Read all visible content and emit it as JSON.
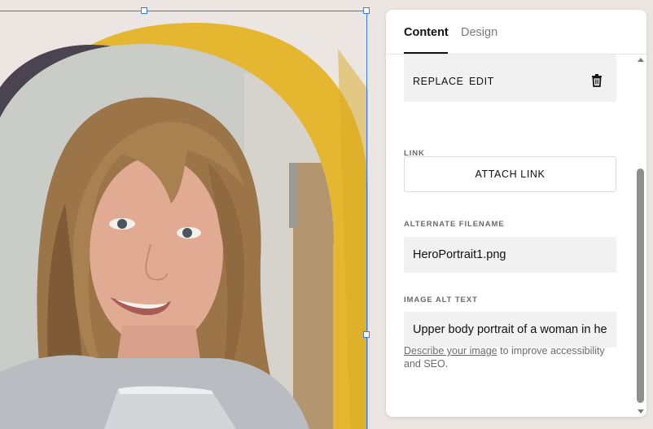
{
  "canvas": {
    "image_alt": "Upper body portrait of a woman",
    "colors": {
      "yellow": "#e5b730",
      "dark_arch": "#4a4350",
      "background": "#ebe6e1",
      "selection": "#3d7be0"
    }
  },
  "panel": {
    "tabs": [
      {
        "label": "Content",
        "active": true
      },
      {
        "label": "Design",
        "active": false
      }
    ],
    "image_actions": {
      "replace": "REPLACE",
      "edit": "EDIT",
      "delete_icon": "trash-icon"
    },
    "link": {
      "label": "LINK",
      "button": "ATTACH LINK"
    },
    "alt_filename": {
      "label": "ALTERNATE FILENAME",
      "value": "HeroPortrait1.png"
    },
    "alt_text": {
      "label": "IMAGE ALT TEXT",
      "value": "Upper body portrait of a woman in he",
      "helper_link": "Describe your image",
      "helper_rest": " to improve accessibility and SEO."
    }
  }
}
